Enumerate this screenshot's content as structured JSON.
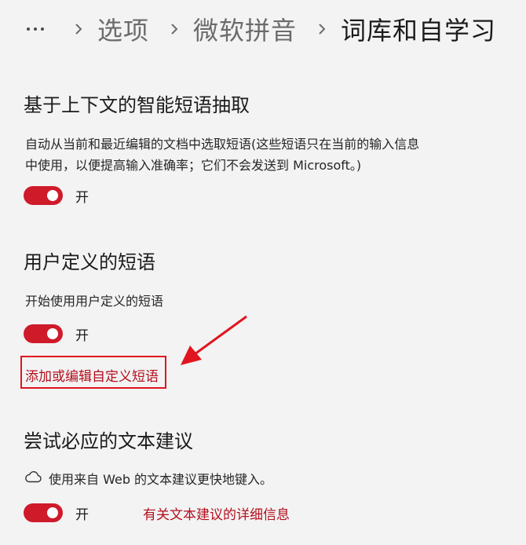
{
  "colors": {
    "accent_toggle": "#cf1a2a",
    "link": "#b30f1d",
    "annotation": "#e1151f"
  },
  "breadcrumb": {
    "more_icon": "more-horizontal-icon",
    "separator_icon": "chevron-right-icon",
    "items": [
      "选项",
      "微软拼音",
      "词库和自学习"
    ]
  },
  "sections": [
    {
      "title": "基于上下文的智能短语抽取",
      "description_lines": [
        "自动从当前和最近编辑的文档中选取短语(这些短语只在当前的输入信息",
        "中使用，以便提高输入准确率；它们不会发送到 Microsoft。)"
      ],
      "toggle_state": "on",
      "toggle_label": "开"
    },
    {
      "title": "用户定义的短语",
      "description": "开始使用用户定义的短语",
      "toggle_state": "on",
      "toggle_label": "开",
      "link": "添加或编辑自定义短语"
    },
    {
      "title": "尝试必应的文本建议",
      "icon": "cloud-icon",
      "description": "使用来自 Web 的文本建议更快地键入。",
      "toggle_state": "on",
      "toggle_label": "开",
      "link": "有关文本建议的详细信息"
    }
  ]
}
